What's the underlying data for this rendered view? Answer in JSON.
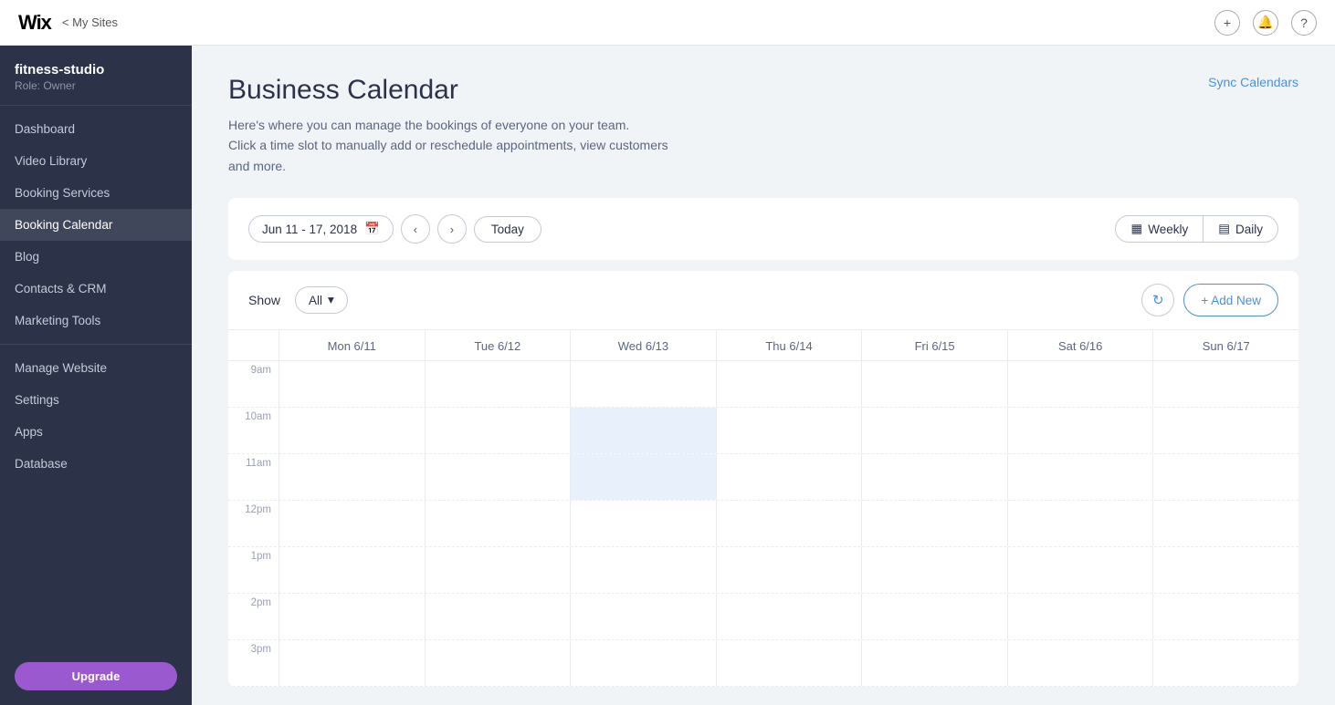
{
  "topbar": {
    "logo": "Wix",
    "my_sites_label": "< My Sites",
    "icons": {
      "plus": "+",
      "bell": "🔔",
      "question": "?"
    }
  },
  "sidebar": {
    "site_name": "fitness-studio",
    "role": "Role: Owner",
    "nav_items": [
      {
        "id": "dashboard",
        "label": "Dashboard",
        "active": false
      },
      {
        "id": "video-library",
        "label": "Video Library",
        "active": false
      },
      {
        "id": "booking-services",
        "label": "Booking Services",
        "active": false
      },
      {
        "id": "booking-calendar",
        "label": "Booking Calendar",
        "active": true
      },
      {
        "id": "blog",
        "label": "Blog",
        "active": false
      },
      {
        "id": "contacts-crm",
        "label": "Contacts & CRM",
        "active": false
      },
      {
        "id": "marketing-tools",
        "label": "Marketing Tools",
        "active": false
      }
    ],
    "bottom_items": [
      {
        "id": "manage-website",
        "label": "Manage Website"
      },
      {
        "id": "settings",
        "label": "Settings"
      },
      {
        "id": "apps",
        "label": "Apps"
      },
      {
        "id": "database",
        "label": "Database"
      }
    ],
    "upgrade_label": "Upgrade"
  },
  "page": {
    "title": "Business Calendar",
    "subtitle_line1": "Here's where you can manage the bookings of everyone on your team.",
    "subtitle_line2": "Click a time slot to manually add or reschedule appointments, view customers",
    "subtitle_line3": "and more.",
    "sync_calendars": "Sync Calendars"
  },
  "calendar_nav": {
    "date_range": "Jun 11 - 17, 2018",
    "today": "Today",
    "weekly": "Weekly",
    "daily": "Daily"
  },
  "calendar_grid": {
    "show_label": "Show",
    "filter_value": "All",
    "refresh_title": "Refresh",
    "add_new": "+ Add New",
    "days": [
      {
        "label": "Mon 6/11"
      },
      {
        "label": "Tue 6/12"
      },
      {
        "label": "Wed 6/13",
        "highlighted": true
      },
      {
        "label": "Thu 6/14"
      },
      {
        "label": "Fri 6/15"
      },
      {
        "label": "Sat 6/16"
      },
      {
        "label": "Sun 6/17"
      }
    ],
    "time_slots": [
      "9am",
      "10am",
      "11am",
      "12pm",
      "1pm",
      "2pm",
      "3pm"
    ]
  }
}
